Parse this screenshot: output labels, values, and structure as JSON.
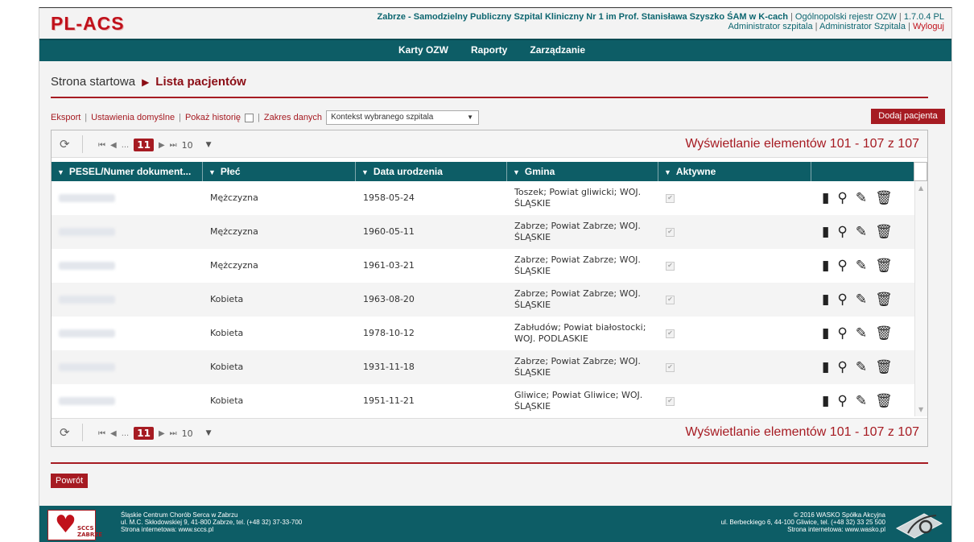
{
  "header": {
    "logo": "PL-ACS",
    "hospital": "Zabrze - Samodzielny Publiczny Szpital Kliniczny Nr 1 im Prof. Stanisława Szyszko ŚAM w K-cach",
    "registry": "Ogólnopolski rejestr OZW",
    "version": "1.7.0.4 PL",
    "role1": "Administrator szpitala",
    "role2": "Administrator Szpitala",
    "logout": "Wyloguj"
  },
  "nav": {
    "items": [
      "Karty OZW",
      "Raporty",
      "Zarządzanie"
    ]
  },
  "breadcrumb": {
    "home": "Strona startowa",
    "current": "Lista pacjentów"
  },
  "toolbar": {
    "export": "Eksport",
    "defaults": "Ustawienia domyślne",
    "history": "Pokaż historię",
    "range": "Zakres danych",
    "range_value": "Kontekst wybranego szpitala",
    "add_patient": "Dodaj pacjenta"
  },
  "pager": {
    "ellipsis": "...",
    "current_page": "11",
    "page_size": "10",
    "info": "Wyświetlanie elementów 101 - 107 z 107"
  },
  "table": {
    "columns": [
      "PESEL/Numer dokument...",
      "Płeć",
      "Data urodzenia",
      "Gmina",
      "Aktywne"
    ],
    "rows": [
      {
        "sex": "Mężczyzna",
        "dob": "1958-05-24",
        "gmina": "Toszek; Powiat gliwicki; WOJ. ŚLĄSKIE"
      },
      {
        "sex": "Mężczyzna",
        "dob": "1960-05-11",
        "gmina": "Zabrze; Powiat Zabrze; WOJ. ŚLĄSKIE"
      },
      {
        "sex": "Mężczyzna",
        "dob": "1961-03-21",
        "gmina": "Zabrze; Powiat Zabrze; WOJ. ŚLĄSKIE"
      },
      {
        "sex": "Kobieta",
        "dob": "1963-08-20",
        "gmina": "Zabrze; Powiat Zabrze; WOJ. ŚLĄSKIE"
      },
      {
        "sex": "Kobieta",
        "dob": "1978-10-12",
        "gmina": "Zabłudów; Powiat białostocki; WOJ. PODLASKIE"
      },
      {
        "sex": "Kobieta",
        "dob": "1931-11-18",
        "gmina": "Zabrze; Powiat Zabrze; WOJ. ŚLĄSKIE"
      },
      {
        "sex": "Kobieta",
        "dob": "1951-11-21",
        "gmina": "Gliwice; Powiat Gliwice; WOJ. ŚLĄSKIE"
      }
    ]
  },
  "back_button": "Powrót",
  "footer": {
    "left_line1": "Śląskie Centrum Chorób Serca w Zabrzu",
    "left_line2": "ul. M.C. Skłodowskiej 9, 41-800 Zabrze, tel. (+48 32) 37-33-700",
    "left_line3": "Strona internetowa: www.sccs.pl",
    "right_line1": "© 2016 WASKO Spółka Akcyjna",
    "right_line2": "ul. Berbeckiego 6, 44-100 Gliwice, tel. (+48 32) 33 25 500",
    "right_line3": "Strona internetowa: www.wasko.pl",
    "logo_text": "SCCS ZABRZE"
  },
  "icons": [
    "refresh-icon",
    "first-page-icon",
    "prev-page-icon",
    "next-page-icon",
    "last-page-icon",
    "filter-icon",
    "card-icon",
    "view-icon",
    "edit-icon",
    "delete-icon"
  ],
  "colors": {
    "accent": "#a61b22",
    "nav": "#0d5d66"
  }
}
